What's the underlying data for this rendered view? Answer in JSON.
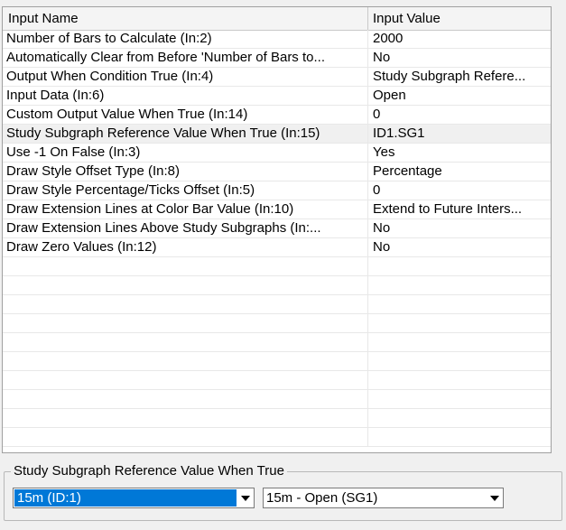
{
  "table": {
    "headers": {
      "name": "Input Name",
      "value": "Input Value"
    },
    "rows": [
      {
        "name": "Number of Bars to Calculate   (In:2)",
        "value": "2000"
      },
      {
        "name": "Automatically Clear from Before 'Number of Bars to...",
        "value": "No"
      },
      {
        "name": "Output When Condition True   (In:4)",
        "value": "Study Subgraph Refere..."
      },
      {
        "name": "Input Data   (In:6)",
        "value": "Open"
      },
      {
        "name": "Custom Output Value When True   (In:14)",
        "value": "0"
      },
      {
        "name": "Study Subgraph Reference Value When True   (In:15)",
        "value": "ID1.SG1"
      },
      {
        "name": "Use -1 On False   (In:3)",
        "value": "Yes"
      },
      {
        "name": "Draw Style Offset Type   (In:8)",
        "value": "Percentage"
      },
      {
        "name": "Draw Style Percentage/Ticks Offset   (In:5)",
        "value": "0"
      },
      {
        "name": "Draw Extension Lines at Color Bar Value   (In:10)",
        "value": "Extend to Future Inters..."
      },
      {
        "name": "Draw Extension Lines Above Study Subgraphs   (In:...",
        "value": "No"
      },
      {
        "name": "Draw Zero Values   (In:12)",
        "value": "No"
      }
    ],
    "selected_row_index": 5,
    "empty_row_count": 10
  },
  "group": {
    "label": "Study Subgraph Reference Value When True",
    "study_select": {
      "value": "15m (ID:1)"
    },
    "subgraph_select": {
      "value": "15m - Open (SG1)"
    }
  }
}
